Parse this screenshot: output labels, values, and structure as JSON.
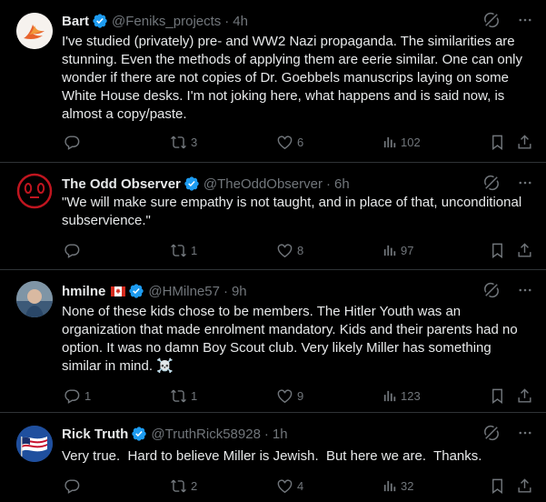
{
  "tweets": [
    {
      "name": "Bart",
      "handle": "@Feniks_projects",
      "time": "4h",
      "flag": false,
      "text": "I've studied (privately) pre- and WW2 Nazi propaganda. The similarities are stunning. Even the methods of applying them are eerie similar. One can only wonder if there are not copies of Dr. Goebbels manuscrips laying on some White House desks. I'm not joking here, what happens and is said now, is almost a copy/paste.",
      "replies": "",
      "reposts": "3",
      "likes": "6",
      "views": "102"
    },
    {
      "name": "The Odd Observer",
      "handle": "@TheOddObserver",
      "time": "6h",
      "flag": false,
      "text": "\"We will make sure empathy is not taught, and in place of that, unconditional subservience.\"",
      "replies": "",
      "reposts": "1",
      "likes": "8",
      "views": "97"
    },
    {
      "name": "hmilne",
      "handle": "@HMilne57",
      "time": "9h",
      "flag": true,
      "text": "None of these kids chose to be members. The Hitler Youth was an organization that made enrolment mandatory. Kids and their parents had no option. It was no damn Boy Scout club. Very likely Miller has something similar in mind. ☠️",
      "replies": "1",
      "reposts": "1",
      "likes": "9",
      "views": "123"
    },
    {
      "name": "Rick Truth",
      "handle": "@TruthRick58928",
      "time": "1h",
      "flag": false,
      "text": "Very true.  Hard to believe Miller is Jewish.  But here we are.  Thanks.",
      "replies": "",
      "reposts": "2",
      "likes": "4",
      "views": "32"
    }
  ],
  "separator": "·",
  "icons": {
    "verified": "verified-badge-icon",
    "grok": "grok-icon",
    "more": "more-icon",
    "reply": "reply-icon",
    "repost": "repost-icon",
    "like": "like-icon",
    "views": "views-icon",
    "bookmark": "bookmark-icon",
    "share": "share-icon",
    "flag": "canada-flag-icon"
  },
  "colors": {
    "background": "#000000",
    "text": "#e7e9ea",
    "muted": "#71767b",
    "border": "#2f3336",
    "verified": "#1d9bf0"
  }
}
